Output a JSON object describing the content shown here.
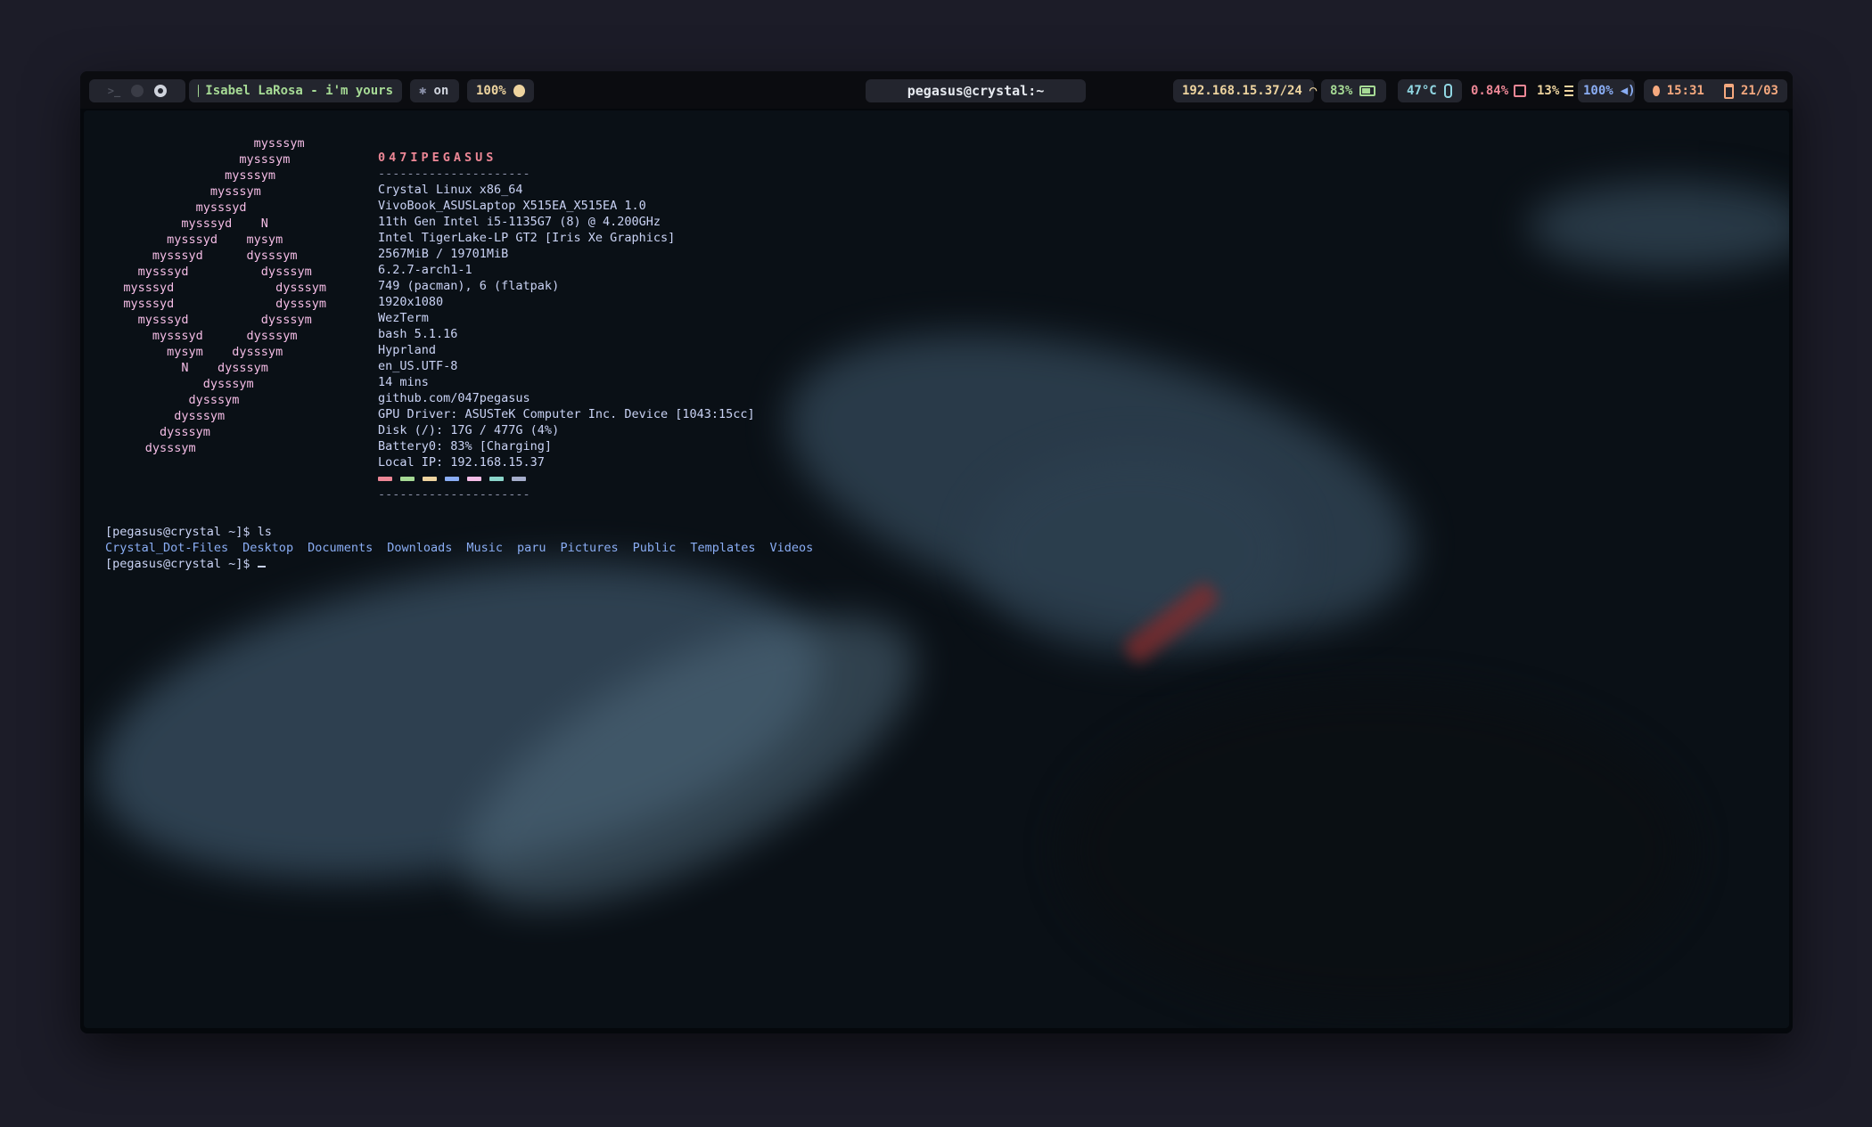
{
  "bar": {
    "media": "Isabel LaRosa - i'm yours",
    "bluetooth": "on",
    "brightness": "100%",
    "window_title": "pegasus@crystal:~",
    "network": "192.168.15.37/24",
    "battery": "83%",
    "temperature": "47°C",
    "cpu": "0.84%",
    "memory": "13%",
    "volume": "100%",
    "time": "15:31",
    "date": "21/03",
    "icons": [
      "terminal-icon",
      "workspace-icon",
      "pause-icon",
      "bluetooth-icon",
      "sun-icon",
      "network-icon",
      "battery-icon",
      "thermometer-icon",
      "cpu-icon",
      "memory-icon",
      "volume-icon",
      "clock-icon",
      "calendar-icon"
    ]
  },
  "fetch": {
    "logo": "                     mysssym\n                   mysssym\n                 mysssym\n               mysssym\n             mysssyd\n           mysssyd    N\n         mysssyd    mysym\n       mysssyd      dysssym\n     mysssyd          dysssym\n   mysssyd              dysssym\n   mysssyd              dysssym\n     mysssyd          dysssym\n       mysssyd      dysssym\n         mysym    dysssym\n           N    dysssym\n              dysssym\n            dysssym\n          dysssym\n        dysssym\n      dysssym",
    "header": "047IPEGASUS",
    "separator": "---------------------",
    "lines": [
      "Crystal Linux x86_64",
      "VivoBook_ASUSLaptop X515EA_X515EA 1.0",
      "11th Gen Intel i5-1135G7 (8) @ 4.200GHz",
      "Intel TigerLake-LP GT2 [Iris Xe Graphics]",
      "2567MiB / 19701MiB",
      "6.2.7-arch1-1",
      "749 (pacman), 6 (flatpak)",
      "1920x1080",
      "WezTerm",
      "bash 5.1.16",
      "Hyprland",
      "en_US.UTF-8",
      "14 mins",
      "github.com/047pegasus",
      "GPU Driver: ASUSTeK Computer Inc. Device [1043:15cc]",
      "Disk (/): 17G / 477G (4%)",
      "Battery0: 83% [Charging]",
      "Local IP: 192.168.15.37"
    ],
    "palette": [
      "#ed8796",
      "#a6da95",
      "#eed49f",
      "#8aadf4",
      "#f5bde6",
      "#8bd5ca",
      "#a5adcb"
    ]
  },
  "shell": {
    "prompt1": "[pegasus@crystal ~]$ ls",
    "ls_output": [
      "Crystal_Dot-Files",
      "Desktop",
      "Documents",
      "Downloads",
      "Music",
      "paru",
      "Pictures",
      "Public",
      "Templates",
      "Videos"
    ],
    "prompt2": "[pegasus@crystal ~]$ "
  }
}
